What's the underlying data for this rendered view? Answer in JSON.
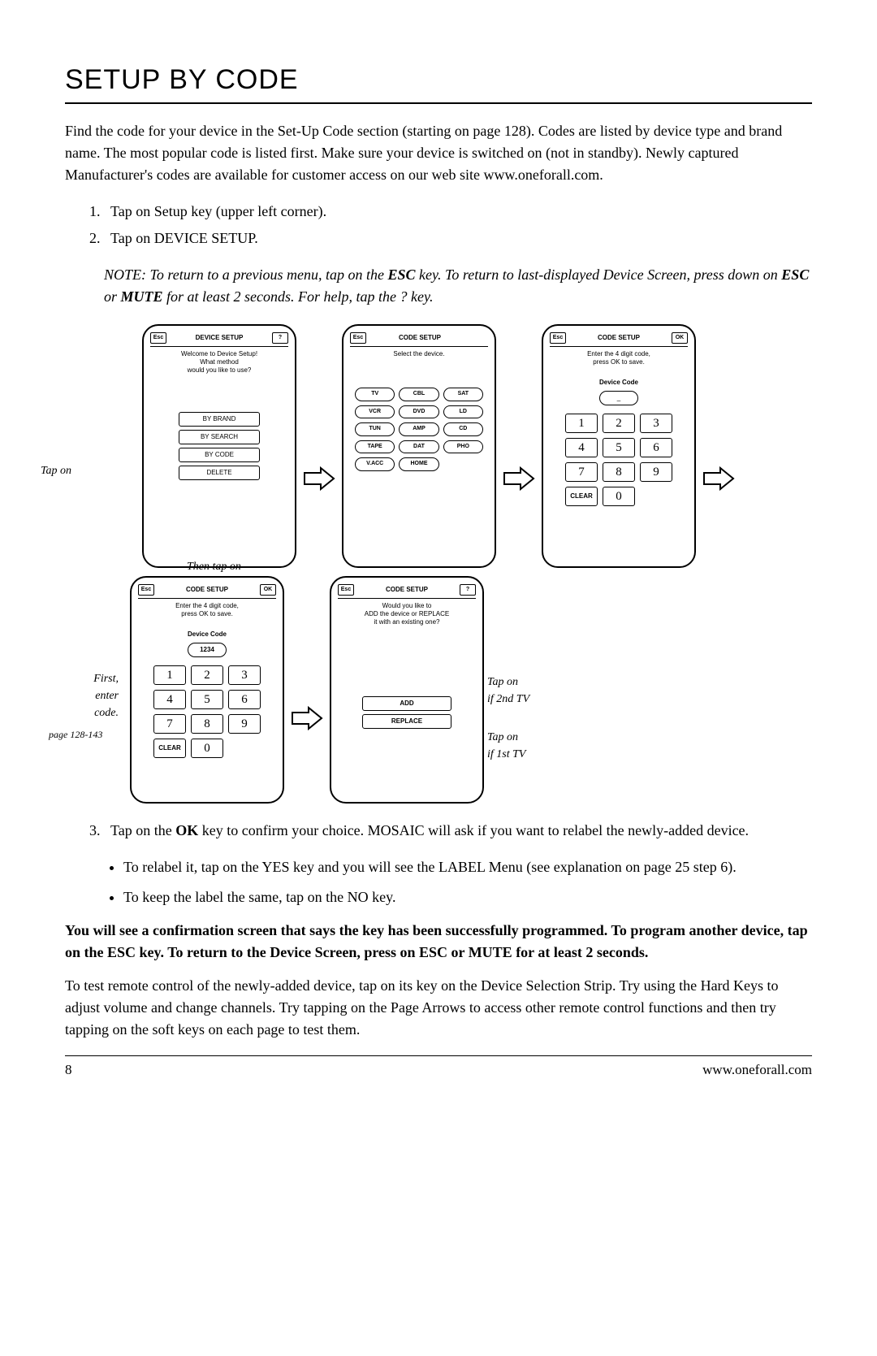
{
  "headline": "SETUP BY CODE",
  "intro": "Find the code for your device in the Set-Up Code section (starting on page 128). Codes are listed by device type and brand name. The most popular code is listed first. Make sure your device is switched on (not in standby). Newly captured Manufacturer's codes are available for customer access on our web site www.oneforall.com.",
  "steps12": {
    "1": "Tap on Setup key (upper left corner).",
    "2": "Tap on DEVICE SETUP."
  },
  "note": {
    "prefix": "NOTE: To return to a previous menu, tap on the ",
    "esc": "ESC",
    "mid1": " key. To return to last-displayed Device Screen, press down on ",
    "mute": "MUTE",
    "mid2": " or ",
    "suffix": " for at least 2 seconds. For help, tap the ? key."
  },
  "remote1": {
    "esc": "Esc",
    "q": "?",
    "title": "DEVICE SETUP",
    "sub1": "Welcome to Device Setup!",
    "sub2": "What method",
    "sub3": "would you like to use?",
    "btns": [
      "BY BRAND",
      "BY SEARCH",
      "BY CODE",
      "DELETE"
    ]
  },
  "remote2": {
    "esc": "Esc",
    "title": "CODE SETUP",
    "sub": "Select the device.",
    "devices": [
      "TV",
      "CBL",
      "SAT",
      "VCR",
      "DVD",
      "LD",
      "TUN",
      "AMP",
      "CD",
      "TAPE",
      "DAT",
      "PHO",
      "V.ACC",
      "HOME"
    ]
  },
  "remote3": {
    "esc": "Esc",
    "ok": "OK",
    "title": "CODE SETUP",
    "sub1": "Enter the 4 digit code,",
    "sub2": "press OK to save.",
    "codelabel": "Device Code",
    "codeval": "_",
    "keys": [
      "1",
      "2",
      "3",
      "4",
      "5",
      "6",
      "7",
      "8",
      "9",
      "CLEAR",
      "0"
    ]
  },
  "remote4": {
    "esc": "Esc",
    "ok": "OK",
    "title": "CODE SETUP",
    "sub1": "Enter the 4 digit code,",
    "sub2": "press OK to save.",
    "codelabel": "Device Code",
    "codeval": "1234",
    "keys": [
      "1",
      "2",
      "3",
      "4",
      "5",
      "6",
      "7",
      "8",
      "9",
      "CLEAR",
      "0"
    ]
  },
  "remote5": {
    "esc": "Esc",
    "q": "?",
    "title": "CODE SETUP",
    "sub1": "Would you like to",
    "sub2": "ADD the device or REPLACE",
    "sub3": "it with an existing one?",
    "add": "ADD",
    "replace": "REPLACE"
  },
  "annot": {
    "tap_on": "Tap on",
    "then_tap_on": "Then tap on",
    "first": "First,",
    "enter": "enter",
    "code": "code.",
    "page_ref": "page 128-143",
    "if2nd": "if 2nd TV",
    "if1st": "if 1st TV"
  },
  "step3": {
    "text": "Tap on the ",
    "ok": "OK",
    "rest": " key to confirm your choice. MOSAIC will ask if you want to relabel the newly-added device."
  },
  "bullets": {
    "b1": "To relabel it, tap on the YES key and you will see the LABEL Menu (see explanation on page 25 step 6).",
    "b2": "To keep the label the same, tap on the NO key."
  },
  "bold_closing": "You will see a confirmation screen that says the key has been successfully programmed. To program another device, tap on the ESC key. To return to the Device Screen, press on ESC or MUTE for at least 2 seconds.",
  "final": "To test remote control of the newly-added device, tap on its key on the Device Selection Strip. Try using the Hard Keys to adjust volume and change channels. Try tapping on the Page Arrows to access other remote control functions and then try tapping on the soft keys on each page to test them.",
  "footer": {
    "page": "8",
    "url": "www.oneforall.com"
  }
}
